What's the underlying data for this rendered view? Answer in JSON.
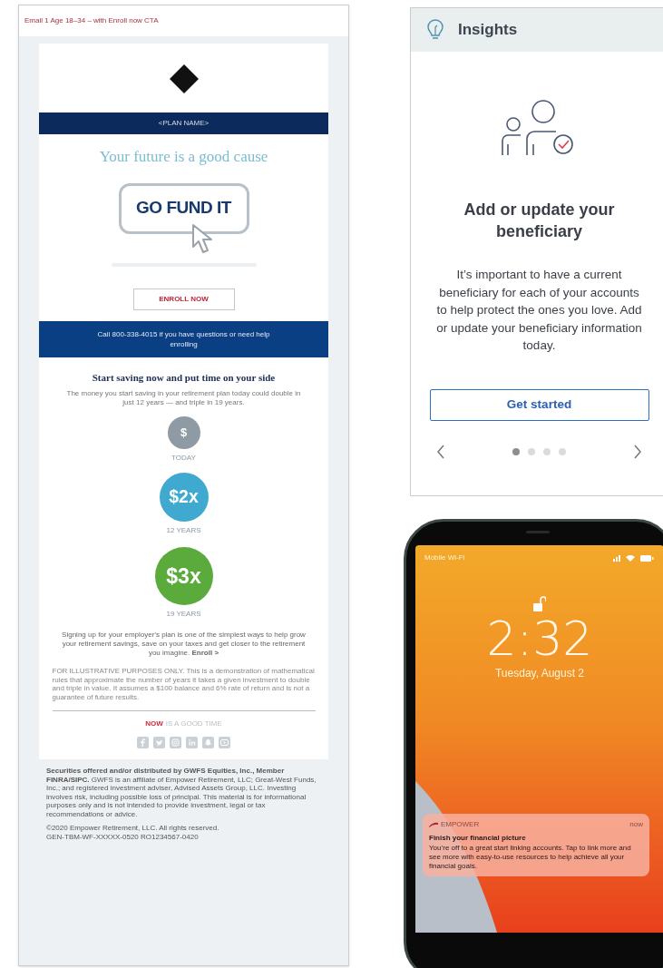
{
  "email": {
    "header_note": "Email 1 Age 18–34 – with Enroll now CTA",
    "plan_name": "<PLAN NAME>",
    "headline": "Your future is a good cause",
    "hero_button": "GO FUND IT",
    "enroll_button": "ENROLL NOW",
    "call_banner": "Call 800-338-4015 if you have questions or need help enrolling",
    "section_title": "Start saving now and put time on your side",
    "intro": "The money you start saving in your retirement plan today could double in just 12 years — and triple in 19 years.",
    "milestones": [
      {
        "amount": "$",
        "label": "TODAY",
        "color": "#8e9ba4"
      },
      {
        "amount": "$2x",
        "label": "12 YEARS",
        "color": "#3fa9d0"
      },
      {
        "amount": "$3x",
        "label": "19 YEARS",
        "color": "#5aab3c"
      }
    ],
    "closing": "Signing up for your employer's plan is one of the simplest ways to help grow your retirement savings, save on your taxes and get closer to the retirement you imagine. **Enroll >**",
    "disclaimer": "FOR ILLUSTRATIVE PURPOSES ONLY. This is a demonstration of mathematical rules that approximate the number of years it takes a given investment to double and triple in value. It assumes a $100 balance and 6% rate of return and is not a guarantee of future results.",
    "tagline_emphasis": "NOW",
    "tagline_rest": "IS A GOOD TIME",
    "legal": "**Securities offered and/or distributed by GWFS Equities, Inc., Member FINRA/SIPC.** GWFS is an affiliate of Empower Retirement, LLC; Great-West Funds, Inc.; and registered investment adviser, Advised Assets Group, LLC. Investing involves risk, including possible loss of principal. This material is for informational purposes only and is not intended to provide investment, legal or tax recommendations or advice.",
    "copyright": [
      "©2020 Empower Retirement, LLC. All rights reserved.",
      "GEN-TBM-WF-XXXXX-0520 RO1234567-0420"
    ]
  },
  "insights": {
    "title": "Insights",
    "heading": "Add or update your beneficiary",
    "body": "It’s important to have a current beneficiary for each of your accounts to help protect the ones you love. Add or update your beneficiary information today.",
    "button": "Get started",
    "pages": [
      {
        "selected": true
      },
      {
        "selected": false
      },
      {
        "selected": false
      },
      {
        "selected": false
      }
    ]
  },
  "phone": {
    "carrier": "Mobile Wi-Fi",
    "time": "2:32",
    "date": "Tuesday, August 2",
    "notification": {
      "app": "EMPOWER",
      "time": "now",
      "title": "Finish your financial picture",
      "body": "You’re off to a great start linking accounts. Tap to link more and see more with easy-to-use resources to help achieve all your financial goals."
    }
  }
}
